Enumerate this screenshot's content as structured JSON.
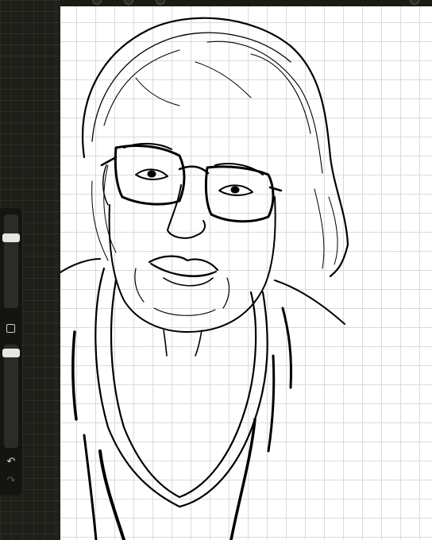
{
  "app": {
    "accent_color": "#e6e6e6",
    "canvas_background": "#ffffff",
    "grid_color": "#d7dade"
  },
  "sidebar": {
    "brush_size": {
      "label": "",
      "value_fraction": 0.78
    },
    "modify_button": {
      "icon": "square-icon"
    },
    "brush_opacity": {
      "label": "",
      "value_fraction": 0.96
    },
    "undo": {
      "icon": "undo-arrow-icon",
      "glyph": "↶"
    },
    "redo": {
      "icon": "redo-arrow-icon",
      "glyph": "↷"
    }
  },
  "canvas": {
    "content": "line-art-portrait"
  }
}
